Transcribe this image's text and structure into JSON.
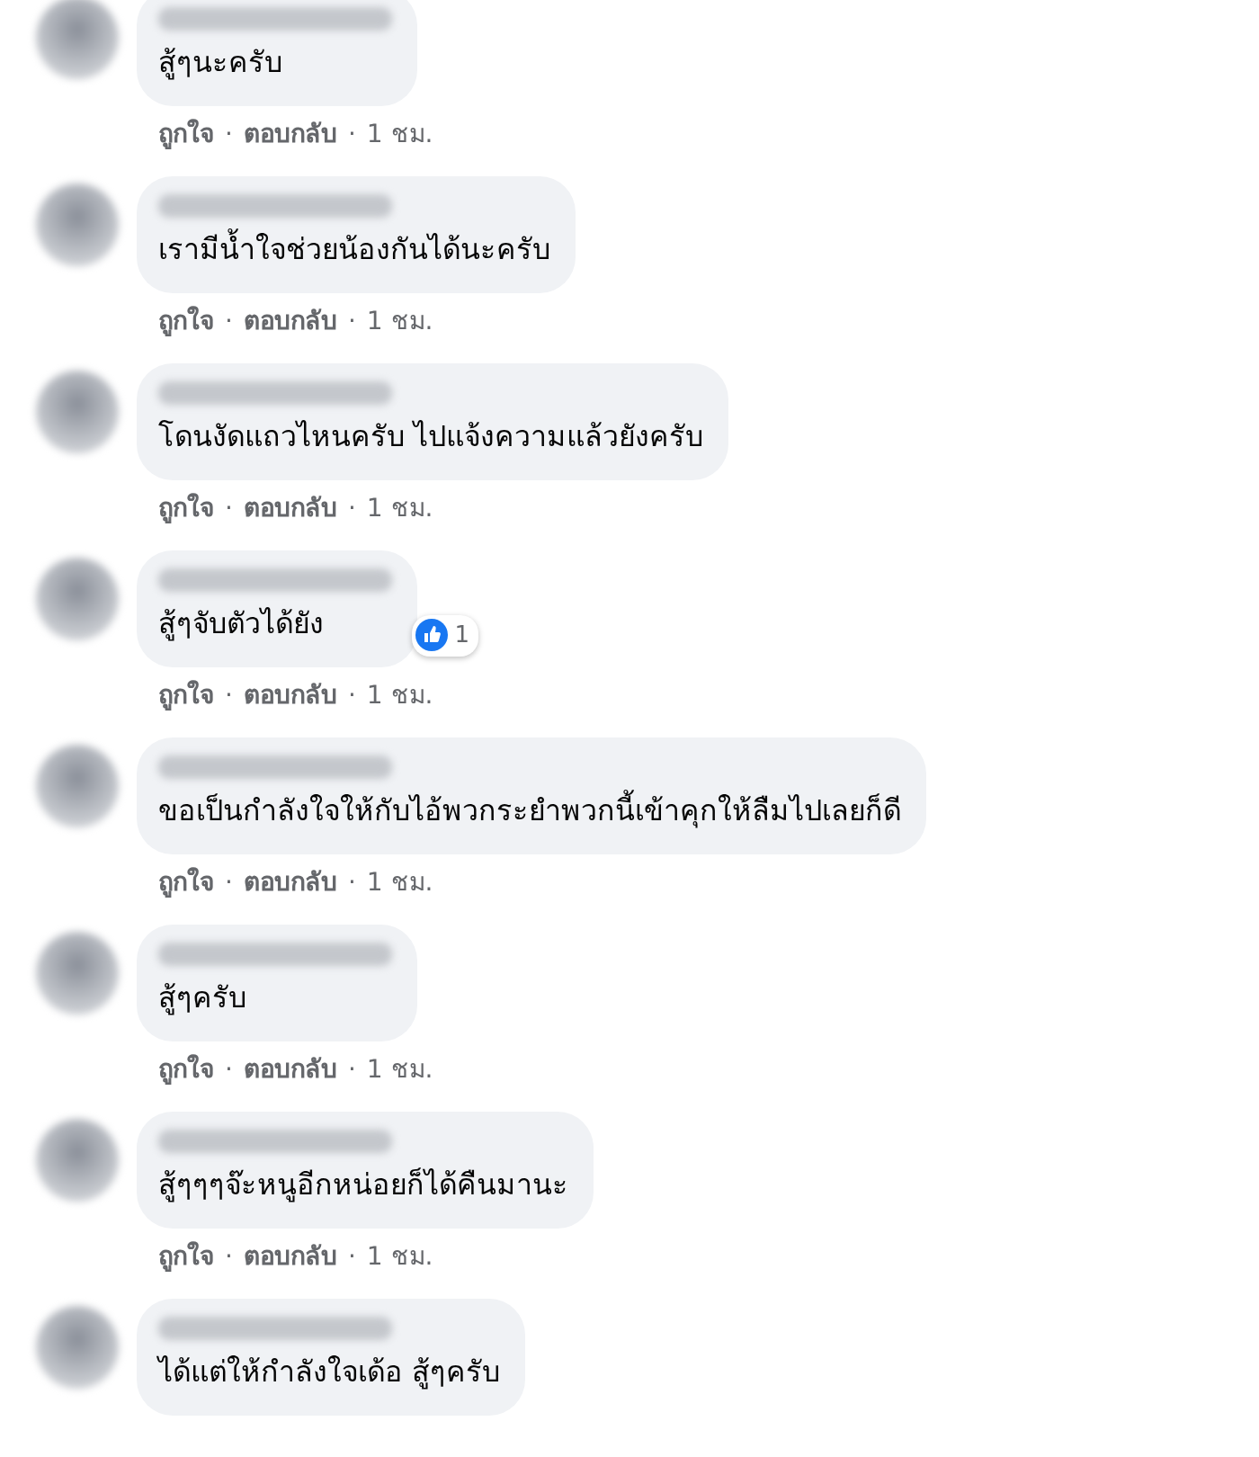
{
  "comments": [
    {
      "text": "สู้ๆนะครับ",
      "actions": [
        {
          "kind": "link",
          "text": "ถูกใจ"
        },
        {
          "kind": "sep",
          "text": "·"
        },
        {
          "kind": "link",
          "text": "ตอบกลับ"
        },
        {
          "kind": "sep",
          "text": "·"
        },
        {
          "kind": "time",
          "text": "1 ชม."
        }
      ]
    },
    {
      "text": "เรามีน้ำใจช่วยน้องกันได้นะครับ",
      "actions": [
        {
          "kind": "link",
          "text": "ถูกใจ"
        },
        {
          "kind": "sep",
          "text": "·"
        },
        {
          "kind": "link",
          "text": "ตอบกลับ"
        },
        {
          "kind": "sep",
          "text": "·"
        },
        {
          "kind": "time",
          "text": "1 ชม."
        }
      ]
    },
    {
      "text": "โดนงัดแถวไหนครับ ไปแจ้งความแล้วยังครับ",
      "actions": [
        {
          "kind": "link",
          "text": "ถูกใจ"
        },
        {
          "kind": "sep",
          "text": "·"
        },
        {
          "kind": "link",
          "text": "ตอบกลับ"
        },
        {
          "kind": "sep",
          "text": "·"
        },
        {
          "kind": "time",
          "text": "1 ชม."
        }
      ]
    },
    {
      "text": "สู้ๆจับตัวได้ยัง",
      "reactions": {
        "count": "1"
      },
      "actions": [
        {
          "kind": "link",
          "text": "ถูกใจ"
        },
        {
          "kind": "sep",
          "text": "·"
        },
        {
          "kind": "link",
          "text": "ตอบกลับ"
        },
        {
          "kind": "sep",
          "text": "·"
        },
        {
          "kind": "time",
          "text": "1 ชม."
        }
      ]
    },
    {
      "text": "ขอเป็นกำลังใจให้กับไอ้พวกระยำพวกนี้เข้าคุกให้ลืมไปเลยก็ดี",
      "actions": [
        {
          "kind": "link",
          "text": "ถูกใจ"
        },
        {
          "kind": "sep",
          "text": "·"
        },
        {
          "kind": "link",
          "text": "ตอบกลับ"
        },
        {
          "kind": "sep",
          "text": "·"
        },
        {
          "kind": "time",
          "text": "1 ชม."
        }
      ]
    },
    {
      "text": "สู้ๆครับ",
      "actions": [
        {
          "kind": "link",
          "text": "ถูกใจ"
        },
        {
          "kind": "sep",
          "text": "·"
        },
        {
          "kind": "link",
          "text": "ตอบกลับ"
        },
        {
          "kind": "sep",
          "text": "·"
        },
        {
          "kind": "time",
          "text": "1 ชม."
        }
      ]
    },
    {
      "text": "สู้ๆๆๆจ๊ะหนูอีกหน่อยก็ได้คืนมานะ",
      "actions": [
        {
          "kind": "link",
          "text": "ถูกใจ"
        },
        {
          "kind": "sep",
          "text": "·"
        },
        {
          "kind": "link",
          "text": "ตอบกลับ"
        },
        {
          "kind": "sep",
          "text": "·"
        },
        {
          "kind": "time",
          "text": "1 ชม."
        }
      ]
    },
    {
      "text": "ได้แต่ให้กำลังใจเด้อ สู้ๆครับ"
    }
  ]
}
